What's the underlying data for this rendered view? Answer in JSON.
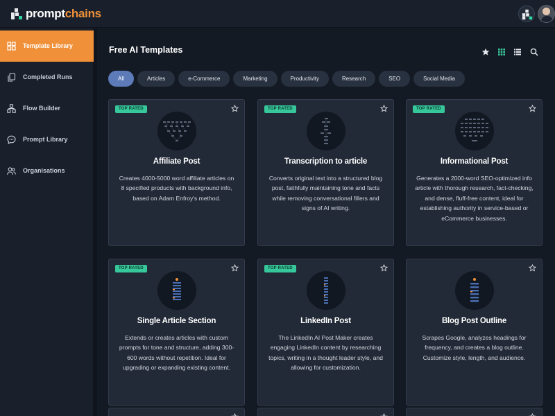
{
  "app": {
    "logo_prefix": "prompt",
    "logo_suffix": "chains",
    "colors": {
      "accent": "#f0913a",
      "badge": "#36c79a",
      "chip_active": "#5c7bb8",
      "background": "#141a24"
    }
  },
  "sidebar": {
    "items": [
      {
        "label": "Template Library",
        "icon": "template-library-icon",
        "active": true
      },
      {
        "label": "Completed Runs",
        "icon": "copy-icon",
        "active": false
      },
      {
        "label": "Flow Builder",
        "icon": "flow-builder-icon",
        "active": false
      },
      {
        "label": "Prompt Library",
        "icon": "chat-bubble-icon",
        "active": false
      },
      {
        "label": "Organisations",
        "icon": "users-icon",
        "active": false
      }
    ]
  },
  "main": {
    "title": "Free AI Templates",
    "toolbar_icons": [
      "star-icon",
      "grid-view-icon",
      "list-view-icon",
      "search-icon"
    ],
    "filters": [
      "All",
      "Articles",
      "e-Commerce",
      "Marketing",
      "Productivity",
      "Research",
      "SEO",
      "Social Media"
    ],
    "active_filter": "All",
    "cards": [
      {
        "badge": "TOP RATED",
        "title": "Affiliate Post",
        "description": "Creates 4000-5000 word affiliate articles on 8 specified products with background info, based on Adam Enfroy's method."
      },
      {
        "badge": "TOP RATED",
        "title": "Transcription to article",
        "description": "Converts original text into a structured blog post, faithfully maintaining tone and facts while removing conversational fillers and signs of AI writing."
      },
      {
        "badge": "TOP RATED",
        "title": "Informational Post",
        "description": "Generates a 2000-word SEO-optimized info article with thorough research, fact-checking, and dense, fluff-free content, ideal for establishing authority in service-based or eCommerce businesses."
      },
      {
        "badge": "TOP RATED",
        "title": "Single Article Section",
        "description": "Extends or creates articles with custom prompts for tone and structure, adding 300-600 words without repetition. Ideal for upgrading or expanding existing content."
      },
      {
        "badge": "TOP RATED",
        "title": "LinkedIn Post",
        "description": "The LinkedIn AI Post Maker creates engaging LinkedIn content by researching topics, writing in a thought leader style, and allowing for customization."
      },
      {
        "badge": "",
        "title": "Blog Post Outline",
        "description": "Scrapes Google, analyzes headings for frequency, and creates a blog outline. Customize style, length, and audience."
      }
    ]
  }
}
